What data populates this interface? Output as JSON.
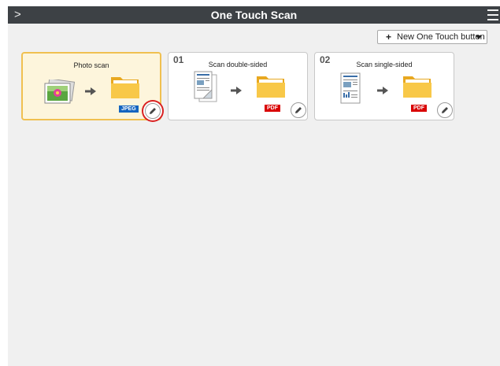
{
  "window": {
    "title": "One Touch Scan"
  },
  "toolbar": {
    "new_button_label": "New One Touch button"
  },
  "cards": [
    {
      "number": "",
      "name": "Photo scan",
      "format": "JPEG",
      "selected": true,
      "source_icon": "photo-stack-icon"
    },
    {
      "number": "01",
      "name": "Scan double-sided",
      "format": "PDF",
      "selected": false,
      "source_icon": "double-sided-document-icon"
    },
    {
      "number": "02",
      "name": "Scan single-sided",
      "format": "PDF",
      "selected": false,
      "source_icon": "single-sided-document-icon"
    }
  ],
  "colors": {
    "titlebar": "#3d4145",
    "selected_card_border": "#f0c050",
    "jpeg_badge": "#1565c0",
    "pdf_badge": "#d90000",
    "highlight": "#d92020"
  }
}
